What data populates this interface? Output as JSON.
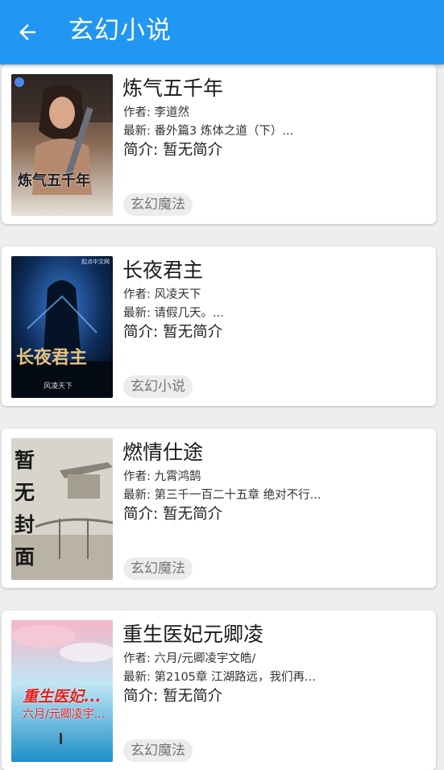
{
  "appbar": {
    "title": "玄幻小说",
    "back_icon": "arrow-left-icon",
    "color": "#2196f3"
  },
  "books": [
    {
      "title": "炼气五千年",
      "author": "作者: 李道然",
      "latest": "最新: 番外篇3 炼体之道（下）...",
      "intro": "简介: 暂无简介",
      "tag": "玄幻魔法",
      "cover_text": "炼气五千年"
    },
    {
      "title": "长夜君主",
      "author": "作者: 风凌天下",
      "latest": "最新: 请假几天。...",
      "intro": "简介: 暂无简介",
      "tag": "玄幻小说",
      "cover_text": "长夜君主",
      "cover_author": "风凌天下",
      "cover_brand": "起点中文网"
    },
    {
      "title": "燃情仕途",
      "author": "作者: 九霄鸿鹄",
      "latest": "最新: 第三千一百二十五章 绝对不行...",
      "intro": "简介: 暂无简介",
      "tag": "玄幻魔法",
      "cover_text": "暂无封面"
    },
    {
      "title": "重生医妃元卿凌",
      "author": "作者: 六月/元卿凌宇文皓/",
      "latest": "最新: 第2105章 江湖路远，我们再...",
      "intro": "简介: 暂无简介",
      "tag": "玄幻魔法",
      "cover_text": "重生医妃...",
      "cover_author": "六月/元卿凌宇..."
    }
  ]
}
